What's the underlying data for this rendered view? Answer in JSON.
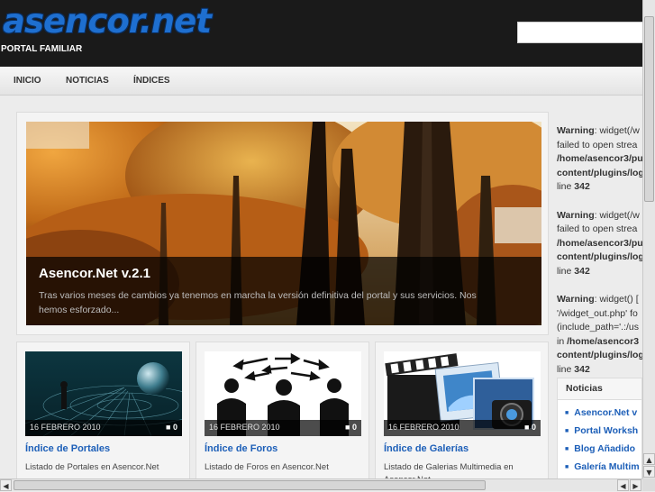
{
  "header": {
    "logo_text": "asencor.net",
    "tagline": "PORTAL FAMILIAR",
    "search_placeholder": ""
  },
  "nav": {
    "items": [
      {
        "label": "INICIO"
      },
      {
        "label": "NOTICIAS"
      },
      {
        "label": "ÍNDICES"
      }
    ]
  },
  "featured": {
    "title": "Asencor.Net v.2.1",
    "excerpt": "Tras varios meses de cambios ya tenemos en marcha la versión definitiva del portal y sus servicios. Nos hemos esforzado..."
  },
  "cards": [
    {
      "date": "16 FEBRERO 2010",
      "comments": "0",
      "title": "Índice de Portales",
      "excerpt": "Listado de Portales en Asencor.Net"
    },
    {
      "date": "16 FEBRERO 2010",
      "comments": "0",
      "title": "Índice de Foros",
      "excerpt": "Listado de Foros en Asencor.Net"
    },
    {
      "date": "16 FEBRERO 2010",
      "comments": "0",
      "title": "Índice de Galerías",
      "excerpt": "Listado de Galerias Multimedia en Asencor.Net"
    }
  ],
  "sidebar": {
    "warnings": [
      {
        "label": "Warning",
        "l1": ": widget(/w",
        "l2": "failed to open strea",
        "l3": "/home/asencor3/pu",
        "l4": "content/plugins/log",
        "l5_pre": "line ",
        "l5_num": "342"
      },
      {
        "label": "Warning",
        "l1": ": widget(/w",
        "l2": "failed to open strea",
        "l3": "/home/asencor3/pu",
        "l4": "content/plugins/log",
        "l5_pre": "line ",
        "l5_num": "342"
      },
      {
        "label": "Warning",
        "l1": ": widget() [",
        "l2": "'/widget_out.php' fo",
        "l3": "(include_path='.:/us",
        "l4_pre": "in ",
        "l4": "/home/asencor3",
        "l5": "content/plugins/log",
        "l6_pre": "line ",
        "l6_num": "342"
      }
    ],
    "news": {
      "heading": "Noticias",
      "items": [
        {
          "label": "Asencor.Net v"
        },
        {
          "label": "Portal Worksh"
        },
        {
          "label": "Blog Añadido"
        },
        {
          "label": "Galería Multim"
        }
      ]
    }
  },
  "colors": {
    "accent": "#1d5fb8",
    "header_bg": "#1a1a1a"
  }
}
